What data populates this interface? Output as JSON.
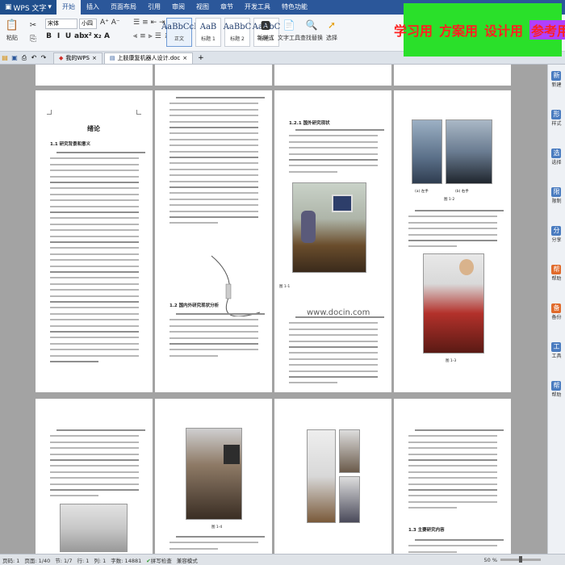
{
  "menubar": {
    "app_label": "WPS 文字",
    "items": [
      "开始",
      "插入",
      "页面布局",
      "引用",
      "审阅",
      "视图",
      "章节",
      "开发工具",
      "特色功能"
    ]
  },
  "ribbon": {
    "font_name": "宋体",
    "font_size": "小四",
    "format_buttons": [
      "B",
      "I",
      "U",
      "ab",
      "x²",
      "x₂",
      "A"
    ],
    "styles": [
      {
        "sample": "AaBbCcI",
        "name": "正文"
      },
      {
        "sample": "AaB",
        "name": "标题 1"
      },
      {
        "sample": "AaBbC",
        "name": "标题 2"
      },
      {
        "sample": "AaBbC",
        "name": "标题 3"
      }
    ],
    "new_style_label": "新样式",
    "text_tools_label": "文字工具",
    "find_replace_label": "查找替换",
    "select_label": "选择"
  },
  "tabs": {
    "items": [
      {
        "label": "我的WPS",
        "active": false
      },
      {
        "label": "上肢康复机器人设计.doc",
        "active": true
      }
    ],
    "add_label": "+"
  },
  "pages": {
    "p1_title": "绪论",
    "p1_section": "1.1 研究背景和意义",
    "p2_section": "1.2 国内外研究现状分析",
    "p3_section": "1.2.1 国外研究现状",
    "p3_caption": "图 1-1",
    "p4_caption_a": "(a) 左手",
    "p4_caption_b": "(b) 右手",
    "p4_fig": "图 1-2",
    "p4_fig2": "图 1-3",
    "p7_caption": "图 1-4",
    "p8_section": "1.3 主要研究内容"
  },
  "sidebar": {
    "items": [
      {
        "icon": "新",
        "label": "新建"
      },
      {
        "icon": "形",
        "label": "样式"
      },
      {
        "icon": "选",
        "label": "选择"
      },
      {
        "icon": "限",
        "label": "限制"
      },
      {
        "icon": "分",
        "label": "分享"
      },
      {
        "icon": "帮",
        "label": "帮助"
      },
      {
        "icon": "备",
        "label": "备份"
      },
      {
        "icon": "工",
        "label": "工具"
      },
      {
        "icon": "帮",
        "label": "帮助"
      }
    ]
  },
  "statusbar": {
    "page": "页码: 1",
    "pages": "页面: 1/40",
    "section": "节: 1/7",
    "row": "行: 1",
    "col": "列: 1",
    "words": "字数: 14881",
    "spell": "拼写检查",
    "mode": "兼容模式",
    "zoom": "50 %",
    "zoom_fraction": 0.5
  },
  "banner": {
    "items": [
      "学习用",
      "方案用",
      "设计用",
      "参考用"
    ]
  },
  "watermark_url": "www.docin.com"
}
